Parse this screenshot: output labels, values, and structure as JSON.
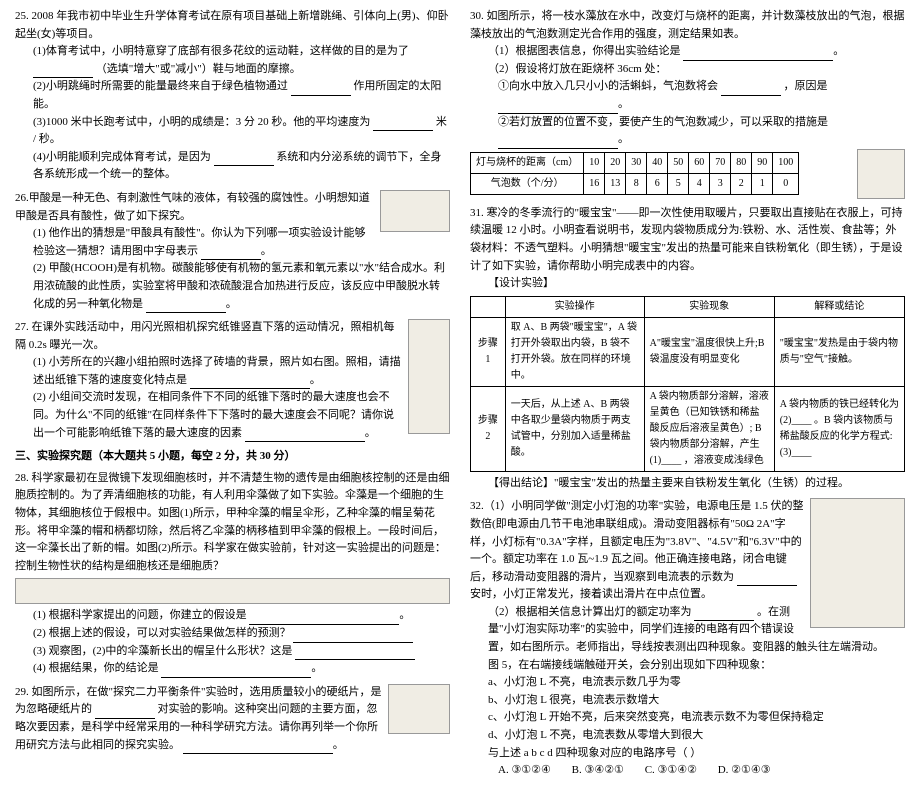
{
  "left": {
    "q25": {
      "stem": "25. 2008 年我市初中毕业生升学体育考试在原有项目基础上新增跳绳、引体向上(男)、仰卧起坐(女)等项目。",
      "s1": "(1)体育考试中，小明特意穿了底部有很多花纹的运动鞋，这样做的目的是为了",
      "s1b": "（选填\"增大\"或\"减小\"）鞋与地面的摩擦。",
      "s2": "(2)小明跳绳时所需要的能量最终来自于绿色植物通过",
      "s2b": "作用所固定的太阳能。",
      "s3": "(3)1000 米中长跑考试中，小明的成绩是：3 分 20 秒。他的平均速度为",
      "s3b": "米 / 秒。",
      "s4": "(4)小明能顺利完成体育考试，是因为",
      "s4b": "系统和内分泌系统的调节下，全身各系统形成一个统一的整体。"
    },
    "q26": {
      "stem": "26.甲酸是一种无色、有刺激性气味的液体，有较强的腐蚀性。小明想知道甲酸是否具有酸性，做了如下探究。",
      "s1": "(1) 他作出的猜想是\"甲酸具有酸性\"。你认为下列哪一项实验设计能够检验这一猜想？请用图中字母表示",
      "s2": "(2) 甲酸(HCOOH)是有机物。碳酸能够使有机物的氢元素和氧元素以\"水\"结合成水。利用浓硫酸的此性质，实验室将甲酸和浓硫酸混合加热进行反应，该反应中甲酸脱水转化成的另一种氧化物是"
    },
    "q27": {
      "stem": "27. 在课外实践活动中，用闪光照相机探究纸锥竖直下落的运动情况，照相机每隔 0.2s 曝光一次。",
      "s1": "(1) 小芳所在的兴趣小组拍照时选择了砖墙的背景，照片如右图。照相，请描述出纸锥下落的速度变化特点是",
      "s2": "(2) 小组间交流时发现，在相同条件下不同的纸锥下落时的最大速度也会不同。为什么\"不同的纸锥\"在同样条件下下落时的最大速度会不同呢？请你说出一个可能影响纸锥下落的最大速度的因素"
    },
    "section3": "三、实验探究题（本大题共 5 小题，每空 2 分，共 30 分）",
    "q28": {
      "stem": "28. 科学家最初在显微镜下发现细胞核时，并不清楚生物的遗传是由细胞核控制的还是由细胞质控制的。为了弄清细胞核的功能，有人利用伞藻做了如下实验。伞藻是一个细胞的生物体，其细胞核位于假根中。如图(1)所示，甲种伞藻的帽呈伞形，乙种伞藻的帽呈菊花形。将甲伞藻的帽和柄都切除，然后将乙伞藻的柄移植到甲伞藻的假根上。一段时间后，这一伞藻长出了新的帽。如图(2)所示。科学家在做实验前，针对这一实验提出的问题是：控制生物性状的结构是细胞核还是细胞质？",
      "s1": "(1) 根据科学家提出的问题，你建立的假设是",
      "s2": "(2) 根据上述的假设，可以对实验结果做怎样的预测？",
      "s3": "(3) 观察图，(2)中的伞藻新长出的帽呈什么形状？这是",
      "s4": "(4) 根据结果，你的结论是"
    },
    "q29": {
      "stem": "29. 如图所示，在做\"探究二力平衡条件\"实验时，选用质量较小的硬纸片，是为忽略硬纸片的",
      "s2": "对实验的影响。这种突出问题的主要方面，忽略次要因素，是科学中经常采用的一种科学研究方法。请你再列举一个你所用研究方法与此相同的探究实验。"
    }
  },
  "right": {
    "q30": {
      "stem": "30. 如图所示，将一枝水藻放在水中，改变灯与烧杯的距离，并计数藻枝放出的气泡，根据藻枝放出的气泡数测定光合作用的强度，测定结果如表。",
      "s1": "（1）根据图表信息，你得出实验结论是",
      "s2": "（2）假设将灯放在距烧杯 36cm 处：",
      "s2a": "①向水中放入几只小小的活蝌蚪，气泡数将会",
      "s2a2": "，原因是",
      "s2b": "②若灯放置的位置不变，要使产生的气泡数减少，可以采取的措施是"
    },
    "t30_header": [
      "灯与烧杯的距离（cm）",
      "10",
      "20",
      "30",
      "40",
      "50",
      "60",
      "70",
      "80",
      "90",
      "100"
    ],
    "t30_row": [
      "气泡数（个/分）",
      "16",
      "13",
      "8",
      "6",
      "5",
      "4",
      "3",
      "2",
      "1",
      "0"
    ],
    "q31": {
      "stem1": "31. 寒冷的冬季流行的\"暖宝宝\"——即一次性使用取暖片，只要取出直接贴在衣服上，可持续温暖 12 小时。小明查看说明书，发现内袋物质成分为:铁粉、水、活性炭、食盐等；外袋材料：不透气塑料。小明猜想\"暖宝宝\"发出的热量可能来自铁粉氧化（即生锈），于是设计了如下实验，请你帮助小明完成表中的内容。",
      "design": "【设计实验】",
      "th_op": "实验操作",
      "th_ph": "实验现象",
      "th_co": "解释或结论",
      "r1_label": "步骤 1",
      "r1_op": "取 A、B 两袋\"暖宝宝\"，A 袋打开外袋取出内袋，B 袋不打开外袋。放在同样的环境中。",
      "r1_ph": "A\"暖宝宝\"温度很快上升;B 袋温度没有明显变化",
      "r1_co": "\"暖宝宝\"发热是由于袋内物质与\"空气\"接触。",
      "r2_label": "步骤 2",
      "r2_op": "一天后，从上述 A、B 两袋中各取少量袋内物质于两支试管中，分别加入适量稀盐酸。",
      "r2_ph": "A 袋内物质部分溶解，溶液呈黄色（已知铁锈和稀盐酸反应后溶液呈黄色）; B 袋内物质部分溶解，产生 (1)____ ，溶液变成浅绿色",
      "r2_co": "A 袋内物质的铁已经转化为 (2)____ 。B 袋内该物质与稀盐酸反应的化学方程式: (3)____",
      "conclusion": "【得出结论】\"暖宝宝\"发出的热量主要来自铁粉发生氧化（生锈）的过程。"
    },
    "q32": {
      "s1": "32.（1）小明同学做\"测定小灯泡的功率\"实验，电源电压是 1.5 伏的整数倍(即电源由几节干电池串联组成)。滑动变阻器标有\"50Ω 2A\"字样，小灯标有\"0.3A\"字样，且额定电压为\"3.8V\"、\"4.5V\"和\"6.3V\"中的一个。额定功率在 1.0 瓦~1.9 瓦之间。他正确连接电路，闭合电键后，移动滑动变阻器的滑片，当观察到电流表的示数为",
      "s1b": "安时，小灯正常发光，接着读出滑片在中点位置。",
      "s2": "（2）根据相关信息计算出灯的额定功率为",
      "s2b": "。在测量\"小灯泡实际功率\"的实验中，同学们连接的电路有四个错误设置，如右图所示。老师指出，导线按表测出四种现象。变阻器的触头往左端滑动。",
      "s3a": "图 5，在右端接线端触碰开关，会分别出现如下四种现象：",
      "a": "a、小灯泡 L 不亮，电流表示数几乎为零",
      "b": "b、小灯泡 L 很亮，电流表示数增大",
      "c": "c、小灯泡 L 开始不亮，后来突然变亮，电流表示数不为零但保持稳定",
      "d": "d、小灯泡 L 不亮，电流表数从零增大到很大",
      "prompt": "与上述 a b c d 四种现象对应的电路序号（  ）",
      "optA": "A. ③①②④",
      "optB": "B. ③④②①",
      "optC": "C. ③①④②",
      "optD": "D. ②①④③"
    }
  }
}
